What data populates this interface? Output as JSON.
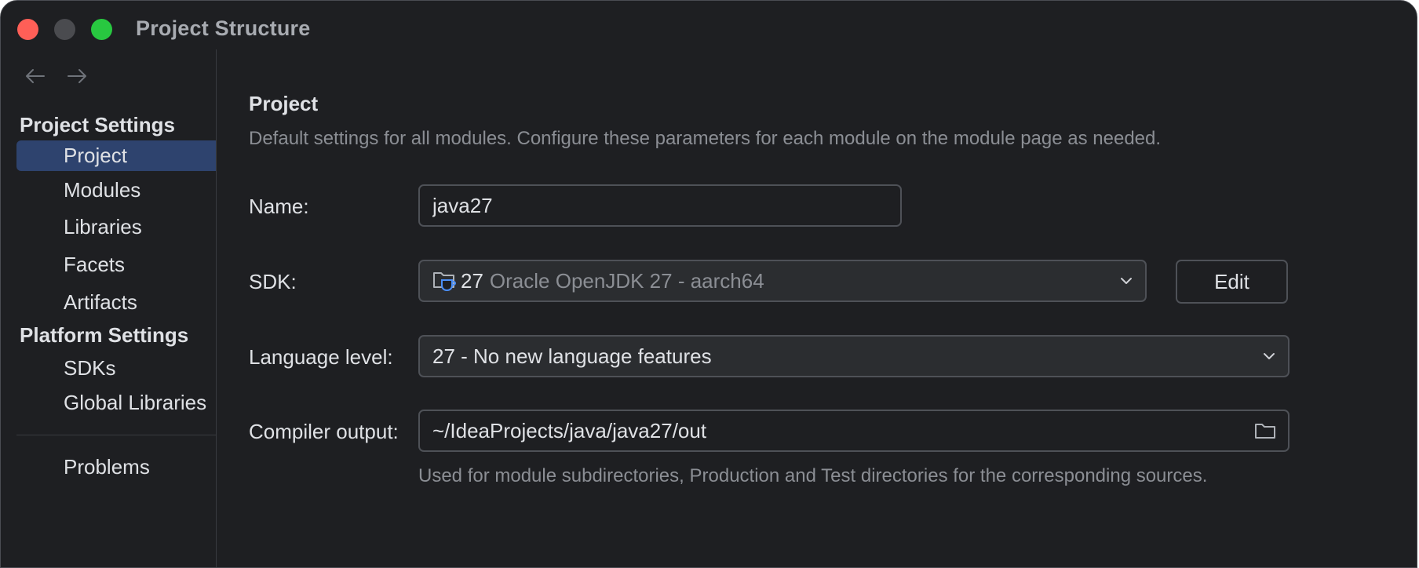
{
  "window": {
    "title": "Project Structure"
  },
  "sidebar": {
    "project_settings_header": "Project Settings",
    "project_items": [
      {
        "label": "Project",
        "selected": true
      },
      {
        "label": "Modules"
      },
      {
        "label": "Libraries"
      },
      {
        "label": "Facets"
      },
      {
        "label": "Artifacts"
      }
    ],
    "platform_settings_header": "Platform Settings",
    "platform_items": [
      {
        "label": "SDKs"
      },
      {
        "label": "Global Libraries"
      }
    ],
    "problems_label": "Problems"
  },
  "content": {
    "title": "Project",
    "description": "Default settings for all modules. Configure these parameters for each module on the module page as needed.",
    "name": {
      "label": "Name:",
      "value": "java27"
    },
    "sdk": {
      "label": "SDK:",
      "version": "27",
      "name": "Oracle OpenJDK 27 - aarch64",
      "edit_label": "Edit"
    },
    "language_level": {
      "label": "Language level:",
      "value": "27 - No new language features"
    },
    "compiler_output": {
      "label": "Compiler output:",
      "value": "~/IdeaProjects/java/java27/out",
      "hint": "Used for module subdirectories, Production and Test directories for the corresponding sources."
    }
  },
  "colors": {
    "background": "#1e1f22",
    "selection": "#2e436e",
    "text": "#dfe1e5",
    "muted_text": "#8b8e94",
    "border": "#4e5157",
    "close": "#ff5f57",
    "maximize": "#28c840"
  },
  "icons": {
    "back": "arrow-left-icon",
    "forward": "arrow-right-icon",
    "sdk": "jdk-folder-icon",
    "dropdown": "chevron-down-icon",
    "browse": "folder-icon"
  }
}
